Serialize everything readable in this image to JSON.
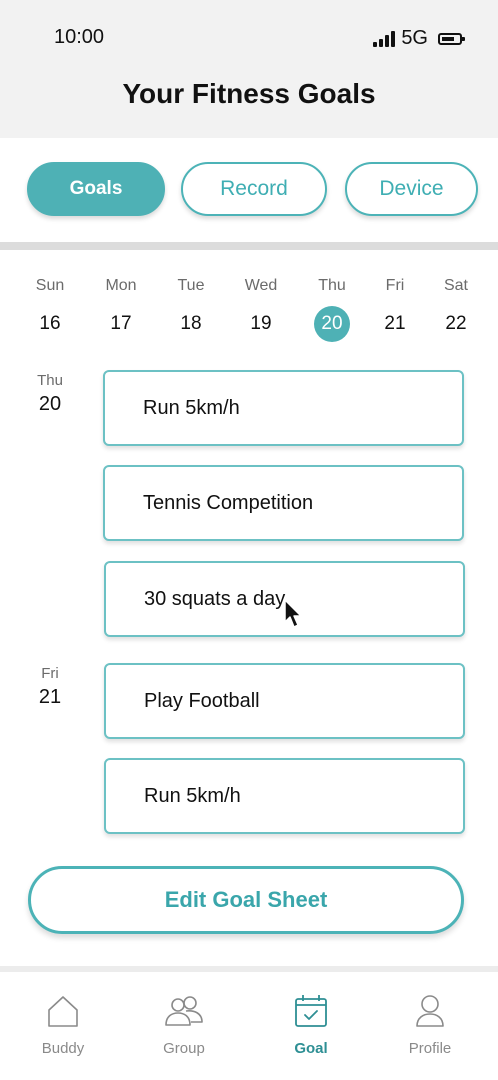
{
  "status_bar": {
    "time": "10:00",
    "network": "5G",
    "icons": [
      "signal-icon",
      "battery-icon"
    ]
  },
  "header": {
    "title": "Your Fitness Goals"
  },
  "tabs": [
    {
      "label": "Goals",
      "active": true
    },
    {
      "label": "Record",
      "active": false
    },
    {
      "label": "Device",
      "active": false
    }
  ],
  "week": [
    {
      "day": "Sun",
      "date": "16"
    },
    {
      "day": "Mon",
      "date": "17"
    },
    {
      "day": "Tue",
      "date": "18"
    },
    {
      "day": "Wed",
      "date": "19"
    },
    {
      "day": "Thu",
      "date": "20",
      "selected": true
    },
    {
      "day": "Fri",
      "date": "21"
    },
    {
      "day": "Sat",
      "date": "22"
    }
  ],
  "schedule": [
    {
      "day": "Thu",
      "date": "20",
      "goals": [
        "Run 5km/h",
        "Tennis Competition",
        "30 squats a day"
      ]
    },
    {
      "day": "Fri",
      "date": "21",
      "goals": [
        "Play Football",
        "Run 5km/h"
      ]
    }
  ],
  "edit_button": {
    "label": "Edit Goal Sheet"
  },
  "bottom_nav": [
    {
      "label": "Buddy",
      "icon": "house-icon"
    },
    {
      "label": "Group",
      "icon": "people-icon"
    },
    {
      "label": "Goal",
      "icon": "calendar-check-icon",
      "active": true
    },
    {
      "label": "Profile",
      "icon": "person-icon"
    }
  ],
  "colors": {
    "accent": "#4eb1b5",
    "accent_text": "#3aa6ab",
    "header_bg": "#f2f2f2"
  }
}
